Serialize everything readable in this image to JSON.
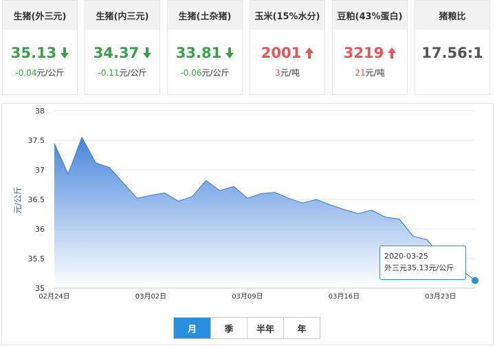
{
  "cards": [
    {
      "title": "生猪(外三元)",
      "value": "35.13",
      "change_num": "-0.04",
      "change_unit": "元/公斤",
      "dir": "down"
    },
    {
      "title": "生猪(内三元)",
      "value": "34.37",
      "change_num": "-0.11",
      "change_unit": "元/公斤",
      "dir": "down"
    },
    {
      "title": "生猪(土杂猪)",
      "value": "33.81",
      "change_num": "-0.06",
      "change_unit": "元/公斤",
      "dir": "down"
    },
    {
      "title": "玉米(15%水分)",
      "value": "2001",
      "change_num": "3",
      "change_unit": "元/吨",
      "dir": "up"
    },
    {
      "title": "豆粕(43%蛋白)",
      "value": "3219",
      "change_num": "21",
      "change_unit": "元/吨",
      "dir": "up"
    },
    {
      "title": "猪粮比",
      "value": "17.56:1",
      "change_num": "",
      "change_unit": "",
      "dir": "none"
    }
  ],
  "colors": {
    "down": "#3aa14a",
    "up": "#e95358",
    "line": "#2b7bd8",
    "accent": "#2b8fe0"
  },
  "tabs": [
    "月",
    "季",
    "半年",
    "年"
  ],
  "tooltip": {
    "date": "2020-03-25",
    "text": "外三元35.13元/公斤"
  },
  "chart_data": {
    "type": "area",
    "ylabel": "元/公斤",
    "ylim": [
      35,
      38
    ],
    "yticks": [
      "35",
      "35.5",
      "36",
      "36.5",
      "37",
      "37.5",
      "38"
    ],
    "xtick_labels": [
      {
        "label": "02月24日",
        "day": 0
      },
      {
        "label": "03月02日",
        "day": 7
      },
      {
        "label": "03月09日",
        "day": 14
      },
      {
        "label": "03月16日",
        "day": 21
      },
      {
        "label": "03月23日",
        "day": 28
      }
    ],
    "day_span": [
      0,
      30.5
    ],
    "series": [
      {
        "points": [
          [
            0,
            37.45
          ],
          [
            1,
            36.93
          ],
          [
            2,
            37.55
          ],
          [
            3,
            37.12
          ],
          [
            4,
            37.04
          ],
          [
            5,
            36.78
          ],
          [
            6,
            36.52
          ],
          [
            7,
            36.57
          ],
          [
            8,
            36.61
          ],
          [
            9,
            36.47
          ],
          [
            10,
            36.55
          ],
          [
            11,
            36.82
          ],
          [
            12,
            36.65
          ],
          [
            13,
            36.72
          ],
          [
            14,
            36.52
          ],
          [
            15,
            36.6
          ],
          [
            16,
            36.62
          ],
          [
            17,
            36.52
          ],
          [
            18,
            36.44
          ],
          [
            19,
            36.5
          ],
          [
            20,
            36.41
          ],
          [
            21,
            36.33
          ],
          [
            22,
            36.26
          ],
          [
            23,
            36.32
          ],
          [
            24,
            36.2
          ],
          [
            25,
            36.17
          ],
          [
            26,
            35.88
          ],
          [
            27,
            35.82
          ],
          [
            28,
            35.55
          ],
          [
            29,
            35.4
          ],
          [
            30.5,
            35.13
          ]
        ]
      }
    ]
  }
}
